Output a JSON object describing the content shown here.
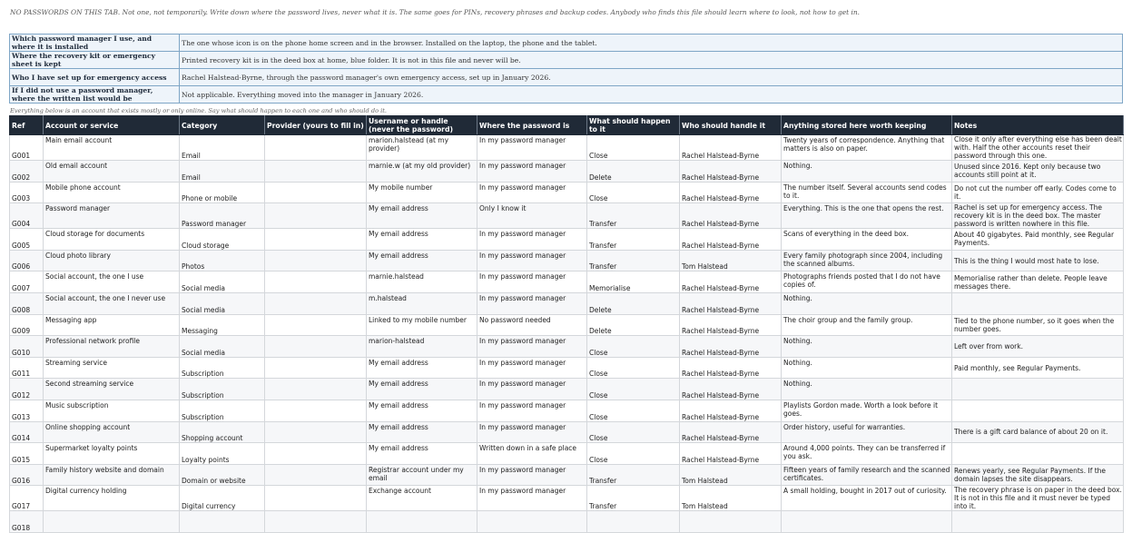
{
  "warning": "NO PASSWORDS ON THIS TAB. Not one, not temporarily. Write down where the password lives, never what it is. The same goes for PINs, recovery phrases and backup codes. Anybody who finds this file should learn where to look, not how to get in.",
  "info": [
    {
      "q": "Which password manager I use, and where it is installed",
      "a": "The one whose icon is on the phone home screen and in the browser. Installed on the laptop, the phone and the tablet."
    },
    {
      "q": "Where the recovery kit or emergency sheet is kept",
      "a": "Printed recovery kit is in the deed box at home, blue folder. It is not in this file and never will be."
    },
    {
      "q": "Who I have set up for emergency access",
      "a": "Rachel Halstead-Byrne, through the password manager's own emergency access, set up in January 2026."
    },
    {
      "q": "If I did not use a password manager, where the written list would be",
      "a": "Not applicable. Everything moved into the manager in January 2026."
    }
  ],
  "note": "Everything below is an account that exists mostly or only online. Say what should happen to each one and who should do it.",
  "columns": [
    "Ref",
    "Account or service",
    "Category",
    "Provider (yours to fill in)",
    "Username or handle (never the password)",
    "Where the password is",
    "What should happen to it",
    "Who should handle it",
    "Anything stored here worth keeping",
    "Notes"
  ],
  "rows": [
    {
      "ref": "G001",
      "account": "Main email account",
      "category": "Email",
      "provider": "",
      "username": "marion.halstead (at my provider)",
      "where": "In my password manager",
      "action": "Close",
      "action_type": "close",
      "who": "Rachel Halstead-Byrne",
      "stored": "Twenty years of correspondence. Anything that matters is also on paper.",
      "notes": "Close it only after everything else has been dealt with. Half the other accounts reset their password through this one."
    },
    {
      "ref": "G002",
      "account": "Old email account",
      "category": "Email",
      "provider": "",
      "username": "marnie.w (at my old provider)",
      "where": "In my password manager",
      "action": "Delete",
      "action_type": "delete",
      "who": "Rachel Halstead-Byrne",
      "stored": "Nothing.",
      "notes": "Unused since 2016. Kept only because two accounts still point at it."
    },
    {
      "ref": "G003",
      "account": "Mobile phone account",
      "category": "Phone or mobile",
      "provider": "",
      "username": "My mobile number",
      "where": "In my password manager",
      "action": "Close",
      "action_type": "close",
      "who": "Rachel Halstead-Byrne",
      "stored": "The number itself. Several accounts send codes to it.",
      "notes": "Do not cut the number off early. Codes come to it."
    },
    {
      "ref": "G004",
      "account": "Password manager",
      "category": "Password manager",
      "provider": "",
      "username": "My email address",
      "where": "Only I know it",
      "action": "Transfer",
      "action_type": "transfer",
      "who": "Rachel Halstead-Byrne",
      "stored": "Everything. This is the one that opens the rest.",
      "notes": "Rachel is set up for emergency access. The recovery kit is in the deed box. The master password is written nowhere in this file."
    },
    {
      "ref": "G005",
      "account": "Cloud storage for documents",
      "category": "Cloud storage",
      "provider": "",
      "username": "My email address",
      "where": "In my password manager",
      "action": "Transfer",
      "action_type": "transfer",
      "who": "Rachel Halstead-Byrne",
      "stored": "Scans of everything in the deed box.",
      "notes": "About 40 gigabytes. Paid monthly, see Regular Payments."
    },
    {
      "ref": "G006",
      "account": "Cloud photo library",
      "category": "Photos",
      "provider": "",
      "username": "My email address",
      "where": "In my password manager",
      "action": "Transfer",
      "action_type": "transfer",
      "who": "Tom Halstead",
      "stored": "Every family photograph since 2004, including the scanned albums.",
      "notes": "This is the thing I would most hate to lose."
    },
    {
      "ref": "G007",
      "account": "Social account, the one I use",
      "category": "Social media",
      "provider": "",
      "username": "marnie.halstead",
      "where": "In my password manager",
      "action": "Memorialise",
      "action_type": "memorialise",
      "who": "Rachel Halstead-Byrne",
      "stored": "Photographs friends posted that I do not have copies of.",
      "notes": "Memorialise rather than delete. People leave messages there."
    },
    {
      "ref": "G008",
      "account": "Social account, the one I never use",
      "category": "Social media",
      "provider": "",
      "username": "m.halstead",
      "where": "In my password manager",
      "action": "Delete",
      "action_type": "delete",
      "who": "Rachel Halstead-Byrne",
      "stored": "Nothing.",
      "notes": ""
    },
    {
      "ref": "G009",
      "account": "Messaging app",
      "category": "Messaging",
      "provider": "",
      "username": "Linked to my mobile number",
      "where": "No password needed",
      "action": "Delete",
      "action_type": "delete",
      "who": "Rachel Halstead-Byrne",
      "stored": "The choir group and the family group.",
      "notes": "Tied to the phone number, so it goes when the number goes."
    },
    {
      "ref": "G010",
      "account": "Professional network profile",
      "category": "Social media",
      "provider": "",
      "username": "marion-halstead",
      "where": "In my password manager",
      "action": "Close",
      "action_type": "close",
      "who": "Rachel Halstead-Byrne",
      "stored": "Nothing.",
      "notes": "Left over from work."
    },
    {
      "ref": "G011",
      "account": "Streaming service",
      "category": "Subscription",
      "provider": "",
      "username": "My email address",
      "where": "In my password manager",
      "action": "Close",
      "action_type": "close",
      "who": "Rachel Halstead-Byrne",
      "stored": "Nothing.",
      "notes": "Paid monthly, see Regular Payments."
    },
    {
      "ref": "G012",
      "account": "Second streaming service",
      "category": "Subscription",
      "provider": "",
      "username": "My email address",
      "where": "In my password manager",
      "action": "Close",
      "action_type": "close",
      "who": "Rachel Halstead-Byrne",
      "stored": "Nothing.",
      "notes": ""
    },
    {
      "ref": "G013",
      "account": "Music subscription",
      "category": "Subscription",
      "provider": "",
      "username": "My email address",
      "where": "In my password manager",
      "action": "Close",
      "action_type": "close",
      "who": "Rachel Halstead-Byrne",
      "stored": "Playlists Gordon made. Worth a look before it goes.",
      "notes": ""
    },
    {
      "ref": "G014",
      "account": "Online shopping account",
      "category": "Shopping account",
      "provider": "",
      "username": "My email address",
      "where": "In my password manager",
      "action": "Close",
      "action_type": "close",
      "who": "Rachel Halstead-Byrne",
      "stored": "Order history, useful for warranties.",
      "notes": "There is a gift card balance of about 20 on it."
    },
    {
      "ref": "G015",
      "account": "Supermarket loyalty points",
      "category": "Loyalty points",
      "provider": "",
      "username": "My email address",
      "where": "Written down in a safe place",
      "action": "Close",
      "action_type": "close",
      "who": "Rachel Halstead-Byrne",
      "stored": "Around 4,000 points. They can be transferred if you ask.",
      "notes": ""
    },
    {
      "ref": "G016",
      "account": "Family history website and domain",
      "category": "Domain or website",
      "provider": "",
      "username": "Registrar account under my email",
      "where": "In my password manager",
      "action": "Transfer",
      "action_type": "transfer",
      "who": "Tom Halstead",
      "stored": "Fifteen years of family research and the scanned certificates.",
      "notes": "Renews yearly, see Regular Payments. If the domain lapses the site disappears."
    },
    {
      "ref": "G017",
      "account": "Digital currency holding",
      "category": "Digital currency",
      "provider": "",
      "username": "Exchange account",
      "where": "In my password manager",
      "action": "Transfer",
      "action_type": "transfer",
      "who": "Tom Halstead",
      "stored": "A small holding, bought in 2017 out of curiosity.",
      "notes": "The recovery phrase is on paper in the deed box. It is not in this file and it must never be typed into it."
    },
    {
      "ref": "G018",
      "account": "",
      "category": "",
      "provider": "",
      "username": "",
      "where": "",
      "action": "",
      "action_type": "",
      "who": "",
      "stored": "",
      "notes": ""
    }
  ],
  "colors": {
    "header_bg": "#202a37",
    "info_bg": "#eef4fa",
    "info_border": "#7fa6c6",
    "delete": "#b3261e",
    "transfer": "#2e7d32",
    "memorialise": "#35608f"
  }
}
